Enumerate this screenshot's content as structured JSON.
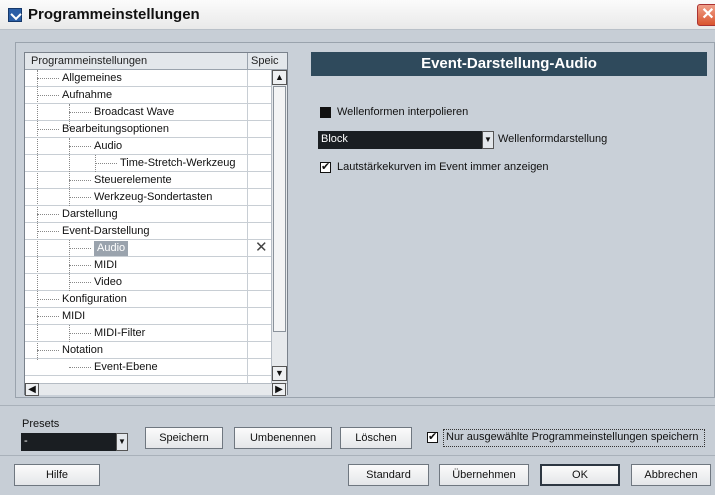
{
  "window": {
    "title": "Programmeinstellungen",
    "close_glyph": "✕"
  },
  "tree": {
    "columns": [
      "Programmeinstellungen",
      "Speic"
    ],
    "items": [
      {
        "label": "Allgemeines",
        "level": 1
      },
      {
        "label": "Aufnahme",
        "level": 1
      },
      {
        "label": "Broadcast Wave",
        "level": 2
      },
      {
        "label": "Bearbeitungsoptionen",
        "level": 1
      },
      {
        "label": "Audio",
        "level": 2
      },
      {
        "label": "Time-Stretch-Werkzeug",
        "level": 3
      },
      {
        "label": "Steuerelemente",
        "level": 2
      },
      {
        "label": "Werkzeug-Sondertasten",
        "level": 2
      },
      {
        "label": "Darstellung",
        "level": 1
      },
      {
        "label": "Event-Darstellung",
        "level": 1
      },
      {
        "label": "Audio",
        "level": 2,
        "selected": true,
        "marked": "✕"
      },
      {
        "label": "MIDI",
        "level": 2
      },
      {
        "label": "Video",
        "level": 2
      },
      {
        "label": "Konfiguration",
        "level": 1
      },
      {
        "label": "MIDI",
        "level": 1
      },
      {
        "label": "MIDI-Filter",
        "level": 2
      },
      {
        "label": "Notation",
        "level": 1
      },
      {
        "label": "Event-Ebene",
        "level": 2
      }
    ]
  },
  "panel": {
    "header": "Event-Darstellung-Audio",
    "interpolate_label": "Wellenformen interpolieren",
    "waveform_value": "Block",
    "waveform_label": "Wellenformdarstellung",
    "volume_curves_label": "Lautstärkekurven im Event immer anzeigen"
  },
  "presets": {
    "label": "Presets",
    "value": "-",
    "save_label": "Speichern",
    "rename_label": "Umbenennen",
    "delete_label": "Löschen",
    "only_selected_label": "Nur ausgewählte Programmeinstellungen speichern"
  },
  "footer": {
    "help_label": "Hilfe",
    "standard_label": "Standard",
    "apply_label": "Übernehmen",
    "ok_label": "OK",
    "cancel_label": "Abbrechen"
  },
  "colors": {
    "header_bg": "#2f4a5c",
    "dialog_bg": "#c9d0d8"
  }
}
